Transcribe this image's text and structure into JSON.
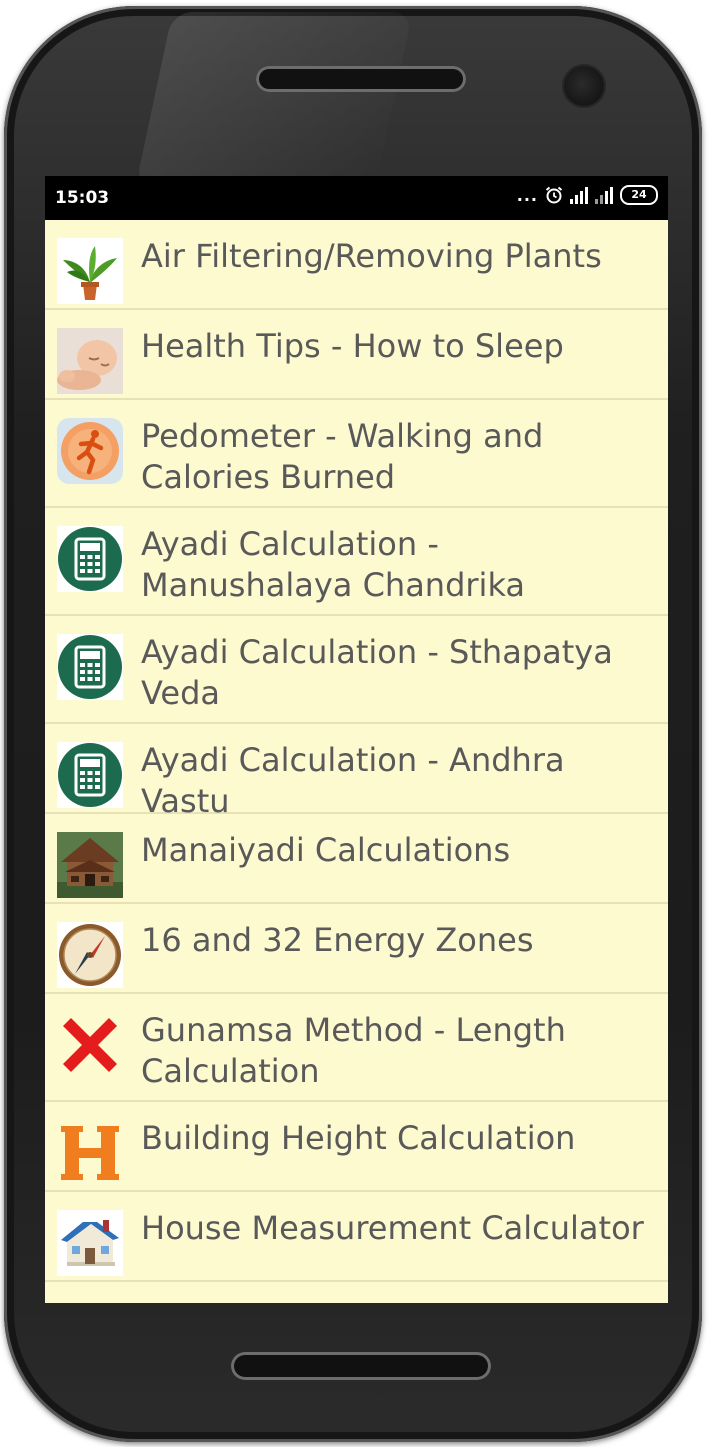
{
  "status_bar": {
    "time": "15:03",
    "dots": "...",
    "battery": "24"
  },
  "items": [
    {
      "label": "Air Filtering/Removing Plants",
      "icon": "plant-icon"
    },
    {
      "label": "Health Tips - How to Sleep",
      "icon": "sleeping-baby-icon"
    },
    {
      "label": "Pedometer - Walking and Calories Burned",
      "icon": "runner-icon"
    },
    {
      "label": "Ayadi Calculation - Manushalaya Chandrika",
      "icon": "calculator-icon"
    },
    {
      "label": "Ayadi Calculation - Sthapatya Veda",
      "icon": "calculator-icon"
    },
    {
      "label": "Ayadi Calculation - Andhra Vastu",
      "icon": "calculator-icon"
    },
    {
      "label": "Manaiyadi Calculations",
      "icon": "traditional-house-icon"
    },
    {
      "label": "16 and 32 Energy Zones",
      "icon": "compass-icon"
    },
    {
      "label": "Gunamsa Method - Length Calculation",
      "icon": "red-x-icon"
    },
    {
      "label": "Building Height Calculation",
      "icon": "letter-h-icon"
    },
    {
      "label": "House Measurement Calculator",
      "icon": "house-icon"
    }
  ],
  "colors": {
    "list_bg": "#fefad0",
    "text": "#595959",
    "divider": "#e6e1b6",
    "calc_green": "#1c6b4e",
    "runner_orange": "#f07a2a",
    "x_red": "#e51c1c",
    "h_orange": "#f07d1e"
  }
}
